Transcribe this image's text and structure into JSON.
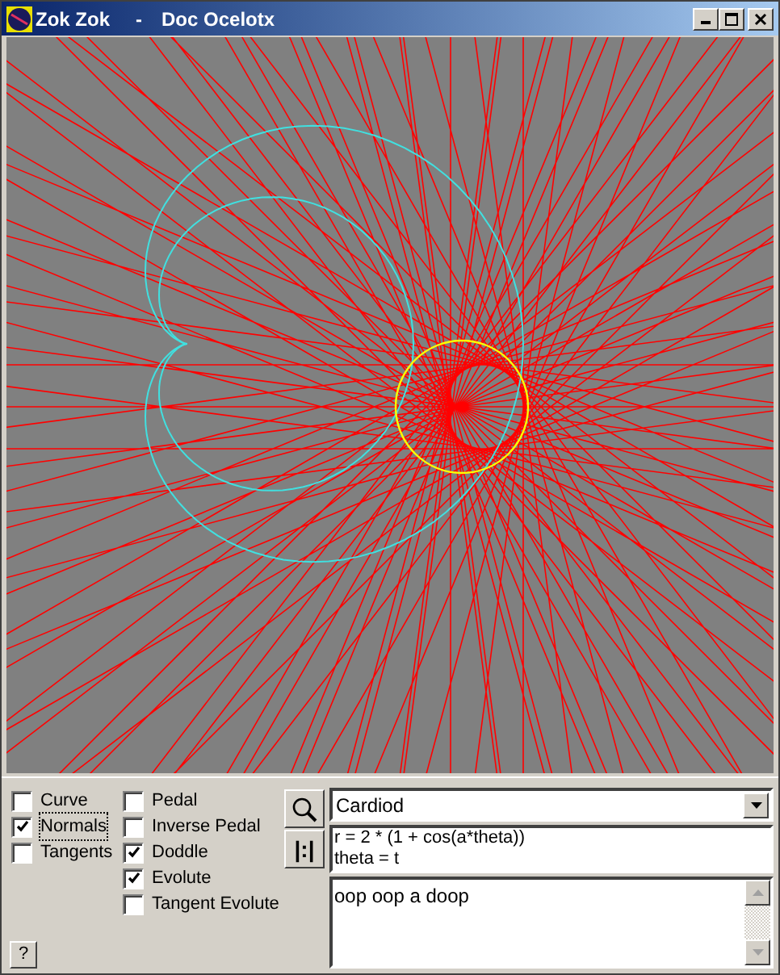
{
  "window": {
    "title": "Zok Zok",
    "separator": "-",
    "document": "Doc Ocelotx"
  },
  "options_left": [
    {
      "label": "Curve",
      "checked": false,
      "focused": false
    },
    {
      "label": "Normals",
      "checked": true,
      "focused": true
    },
    {
      "label": "Tangents",
      "checked": false,
      "focused": false
    }
  ],
  "options_right": [
    {
      "label": "Pedal",
      "checked": false,
      "focused": false
    },
    {
      "label": "Inverse Pedal",
      "checked": false,
      "focused": false
    },
    {
      "label": "Doddle",
      "checked": true,
      "focused": false
    },
    {
      "label": "Evolute",
      "checked": true,
      "focused": false
    },
    {
      "label": "Tangent Evolute",
      "checked": false,
      "focused": false
    }
  ],
  "split_button": "|:|",
  "help_button": "?",
  "curve_select": {
    "value": "Cardiod"
  },
  "formula": [
    "r = 2 * (1 + cos(a*theta))",
    "theta = t"
  ],
  "notes": "oop oop a doop"
}
